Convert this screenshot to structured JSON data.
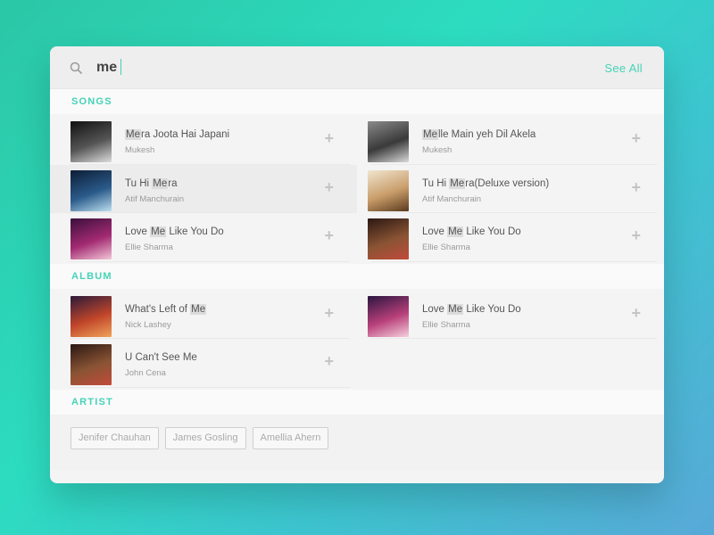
{
  "search": {
    "query": "me",
    "see_all_label": "See All"
  },
  "sections": {
    "songs": "SONGS",
    "album": "ALBUM",
    "artist": "ARTIST"
  },
  "songs": [
    {
      "pre": "",
      "hl": "Me",
      "post": "ra Joota Hai Japani",
      "sub": "Mukesh",
      "cover": [
        "#111111",
        "#555555",
        "#dddddd"
      ],
      "highlighted": false
    },
    {
      "pre": "",
      "hl": "Me",
      "post": "lle Main yeh Dil Akela",
      "sub": "Mukesh",
      "cover": [
        "#8a8a8a",
        "#3a3a3a",
        "#d9d9d9"
      ],
      "highlighted": false
    },
    {
      "pre": "Tu Hi ",
      "hl": "Me",
      "post": "ra",
      "sub": "Atif Manchurain",
      "cover": [
        "#0d1d35",
        "#2a5a8a",
        "#bde0f0"
      ],
      "highlighted": true
    },
    {
      "pre": "Tu Hi ",
      "hl": "Me",
      "post": "ra(Deluxe version)",
      "sub": "Atif Manchurain",
      "cover": [
        "#f0e6d0",
        "#c99d6a",
        "#5a3a1e"
      ],
      "highlighted": false
    },
    {
      "pre": "Love ",
      "hl": "Me",
      "post": " Like You Do",
      "sub": "Ellie Sharma",
      "cover": [
        "#3a0f3c",
        "#a32a72",
        "#f3c7d8"
      ],
      "highlighted": false
    },
    {
      "pre": "Love ",
      "hl": "Me",
      "post": " Like You Do",
      "sub": "Ellie Sharma",
      "cover": [
        "#2a1712",
        "#8a5434",
        "#c24a3a"
      ],
      "highlighted": false
    }
  ],
  "albums": [
    {
      "pre": "What's Left of ",
      "hl": "Me",
      "post": "",
      "sub": "Nick Lashey",
      "cover": [
        "#2a1a3a",
        "#c0452a",
        "#f0a35a"
      ]
    },
    {
      "pre": "Love ",
      "hl": "Me",
      "post": " Like You Do",
      "sub": "Ellie Sharma",
      "cover": [
        "#2a1540",
        "#b8407a",
        "#f5d0dd"
      ]
    },
    {
      "pre": "U Can't See Me",
      "hl": "",
      "post": "",
      "sub": "John Cena",
      "cover": [
        "#2a1712",
        "#8a5434",
        "#c24a3a"
      ]
    }
  ],
  "artists": [
    "Jenifer Chauhan",
    "James Gosling",
    "Amellia Ahern"
  ],
  "colors": {
    "accent": "#45d3b7",
    "panel": "#f4f4f4",
    "plus": "#c4c4c4"
  },
  "icons": {
    "search": "search-icon",
    "add": "plus-icon"
  }
}
